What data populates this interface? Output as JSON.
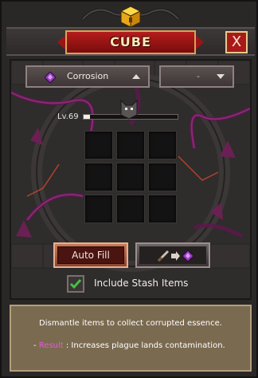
{
  "window": {
    "title": "CUBE",
    "close_label": "X"
  },
  "filters": {
    "left": {
      "label": "Corrosion",
      "icon": "purple-gem-icon"
    },
    "right": {
      "label": "-"
    }
  },
  "level": {
    "label": "Lv.69",
    "progress": 0.07
  },
  "grid": {
    "rows": 3,
    "cols": 3
  },
  "buttons": {
    "auto_fill": "Auto Fill",
    "convert_icon": "sword-to-gem-icon"
  },
  "stash": {
    "checked": true,
    "label": "Include Stash Items"
  },
  "description": {
    "line1": "Dismantle items to collect corrupted essence.",
    "prefix": "- ",
    "result_label": "Result",
    "result_text": " : Increases plague lands contamination."
  },
  "colors": {
    "accent_red": "#b51c1c",
    "gold": "#d9a35a",
    "purple": "#9b3bc2",
    "checkbox_green": "#43c243",
    "result_highlight": "#e35ad8"
  }
}
